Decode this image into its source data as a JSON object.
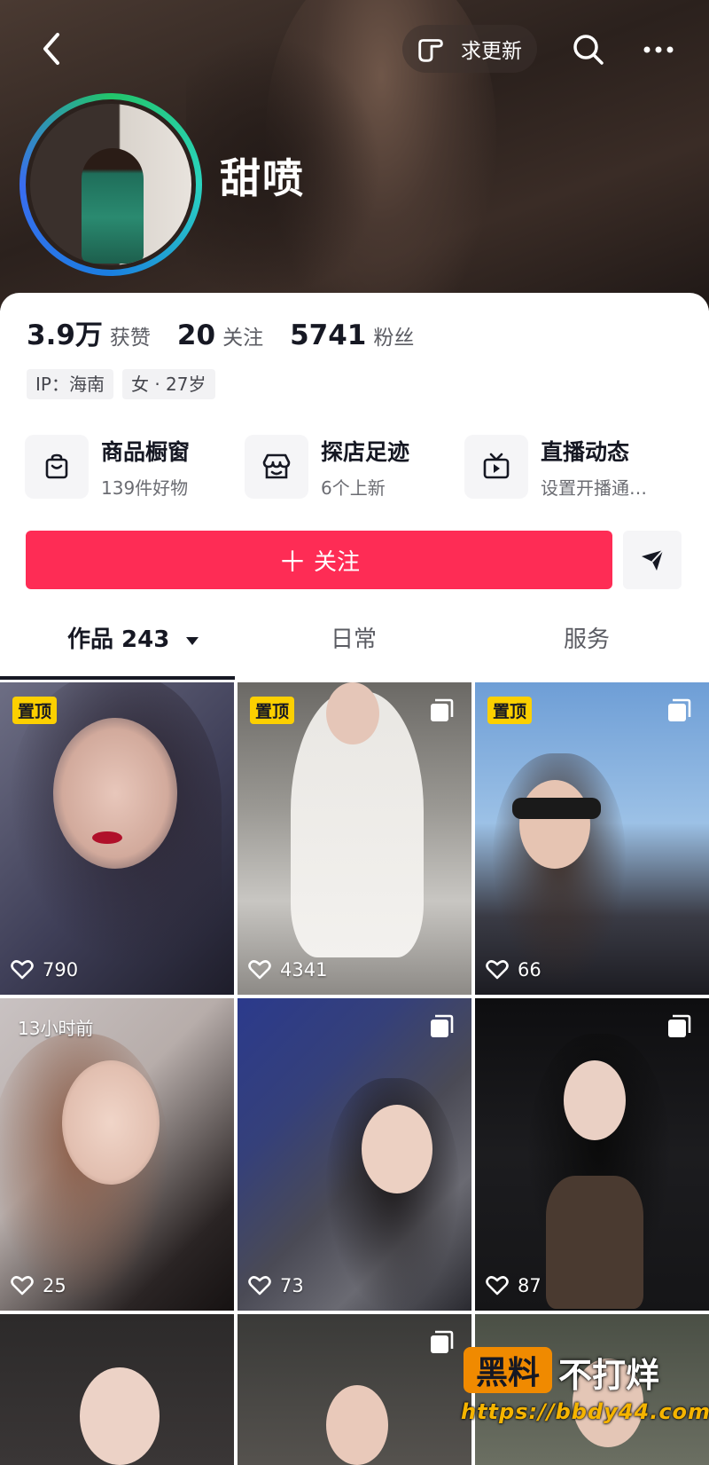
{
  "header": {
    "request_update_label": "求更新",
    "username": "甜喷"
  },
  "stats": [
    {
      "num": "3.9万",
      "label": "获赞"
    },
    {
      "num": "20",
      "label": "关注"
    },
    {
      "num": "5741",
      "label": "粉丝"
    }
  ],
  "tags": [
    "IP：海南",
    "女 · 27岁"
  ],
  "features": [
    {
      "title": "商品橱窗",
      "sub": "139件好物",
      "icon": "shopping-bag-icon"
    },
    {
      "title": "探店足迹",
      "sub": "6个上新",
      "icon": "store-icon"
    },
    {
      "title": "直播动态",
      "sub": "设置开播通…",
      "icon": "tv-icon"
    }
  ],
  "actions": {
    "follow_label": "关注"
  },
  "tabs": [
    {
      "label": "作品 243"
    },
    {
      "label": "日常"
    },
    {
      "label": "服务"
    }
  ],
  "videos": [
    {
      "likes": "790",
      "badge": "置顶",
      "multi": false
    },
    {
      "likes": "4341",
      "badge": "置顶",
      "multi": true
    },
    {
      "likes": "66",
      "badge": "置顶",
      "multi": true
    },
    {
      "likes": "25",
      "time": "13小时前",
      "multi": false
    },
    {
      "likes": "73",
      "multi": true
    },
    {
      "likes": "87",
      "multi": true
    },
    {
      "multi": false
    },
    {
      "multi": true
    },
    {
      "multi": false
    }
  ],
  "watermark": {
    "brand": "黑料",
    "slogan": "不打烊",
    "url": "https://bbdy44.com"
  },
  "colors": {
    "accent": "#fe2c55",
    "pin": "#fcd000"
  }
}
